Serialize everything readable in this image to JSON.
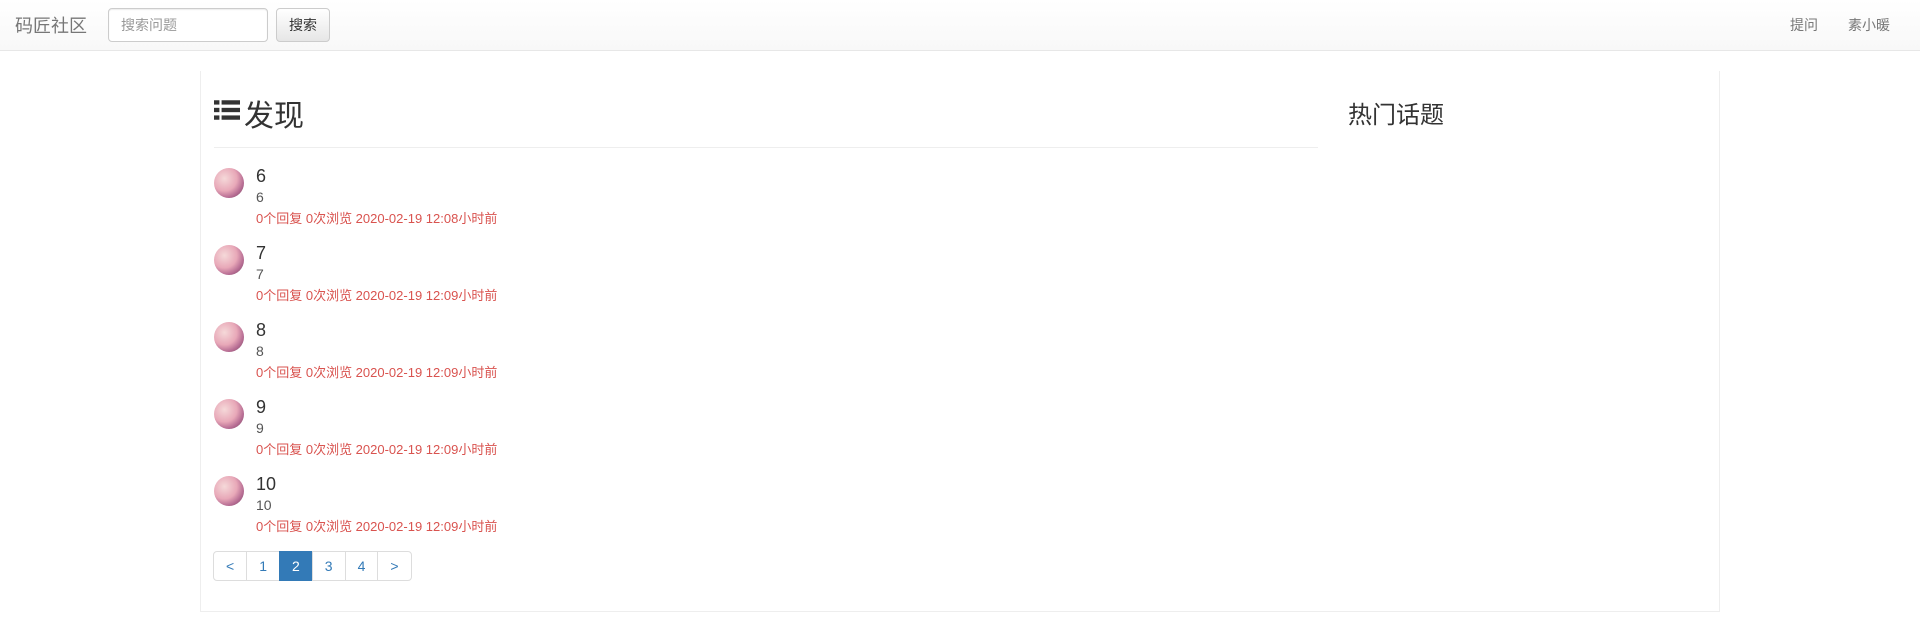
{
  "navbar": {
    "brand": "码匠社区",
    "search_placeholder": "搜索问题",
    "search_button": "搜索",
    "links": {
      "ask": "提问",
      "user": "素小暖"
    }
  },
  "main": {
    "title": "发现",
    "questions": [
      {
        "title": "6",
        "sub": "6",
        "meta": "0个回复 0次浏览 2020-02-19 12:08小时前"
      },
      {
        "title": "7",
        "sub": "7",
        "meta": "0个回复 0次浏览 2020-02-19 12:09小时前"
      },
      {
        "title": "8",
        "sub": "8",
        "meta": "0个回复 0次浏览 2020-02-19 12:09小时前"
      },
      {
        "title": "9",
        "sub": "9",
        "meta": "0个回复 0次浏览 2020-02-19 12:09小时前"
      },
      {
        "title": "10",
        "sub": "10",
        "meta": "0个回复 0次浏览 2020-02-19 12:09小时前"
      }
    ],
    "pagination": {
      "prev": "<",
      "pages": [
        "1",
        "2",
        "3",
        "4"
      ],
      "active_index": 1,
      "next": ">"
    }
  },
  "sidebar": {
    "hot_title": "热门话题"
  }
}
